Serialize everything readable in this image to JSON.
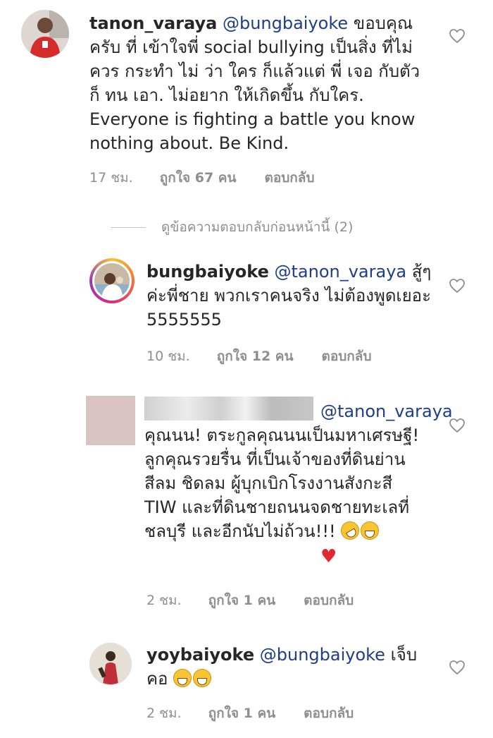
{
  "comments": [
    {
      "username": "tanon_varaya",
      "mention": "@bungbaiyoke",
      "text": " ขอบคุณครับ ที่ เข้าใจพี่ social bullying เป็นสิ่ง ที่ไม่ควร กระทำ ไม่ ว่า ใคร ก็แล้วแต่ พี่ เจอ กับตัว ก็ ทน เอา. ไม่อยาก ให้เกิดขึ้น กับใคร. Everyone is fighting a battle you know nothing about. Be Kind.",
      "time": "17 ชม.",
      "likes": "ถูกใจ 67 คน",
      "reply": "ตอบกลับ"
    },
    {
      "username": "bungbaiyoke",
      "mention": "@tanon_varaya",
      "text": " สู้ๆ ค่ะพี่ชาย พวกเราคนจริง ไม่ต้องพูดเยอะ 5555555",
      "time": "10 ชม.",
      "likes": "ถูกใจ 12 คน",
      "reply": "ตอบกลับ"
    },
    {
      "username": "",
      "mention": "@tanon_varaya",
      "text": " คุณนน! ตระกูลคุณนนเป็นมหาเศรษฐี! ลูกคุณรวยรื่น ที่เป็นเจ้าของที่ดินย่าน สีลม ชิดลม ผู้บุกเบิกโรงงานสังกะสี TIW และที่ดินชายถนนจดชายทะเลที่ชลบุรี และอีกนับไม่ถ้วน!!!",
      "time": "2 ชม.",
      "likes": "ถูกใจ 1 คน",
      "reply": "ตอบกลับ"
    },
    {
      "username": "yoybaiyoke",
      "mention": "@bungbaiyoke",
      "text": " เจ็บคอ",
      "time": "2 ชม.",
      "likes": "ถูกใจ 1 คน",
      "reply": "ตอบกลับ"
    }
  ],
  "view_replies": "ดูข้อความตอบกลับก่อนหน้านี้ (2)",
  "icons": {
    "heart": "heart-outline-icon",
    "emoji": [
      "rofl-emoji",
      "grin-emoji",
      "red-heart-emoji"
    ]
  },
  "colors": {
    "mention": "#1e3d8a",
    "meta": "#8e8e8e",
    "heart_emoji": "#e3262f"
  }
}
